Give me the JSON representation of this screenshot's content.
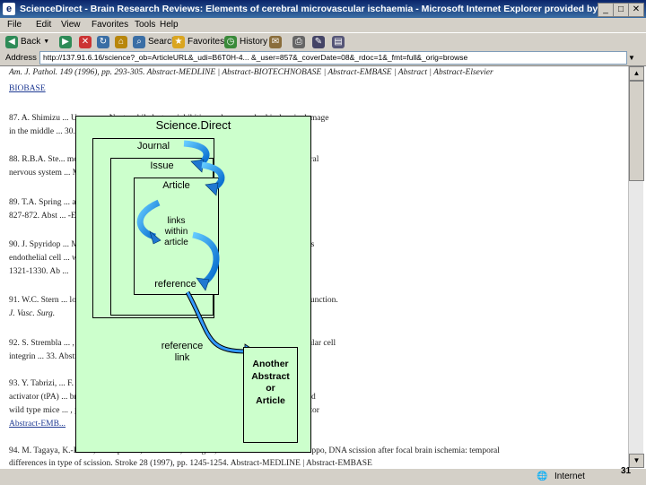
{
  "window": {
    "title": "ScienceDirect - Brain Research Reviews: Elements of cerebral microvascular ischaemia - Microsoft Internet Explorer provided by"
  },
  "menu": [
    "File",
    "Edit",
    "View",
    "Favorites",
    "Tools",
    "Help"
  ],
  "toolbar": {
    "back": "Back",
    "search": "Search",
    "favorites": "Favorites",
    "history": "History"
  },
  "address": {
    "label": "Address",
    "url": "http://137.91.6.16/science?_ob=ArticleURL&_udi=B6T0H-4... &_user=857&_coverDate=08&_rdoc=1&_fmt=full&_orig=browse"
  },
  "content": {
    "lines": [
      {
        "id": "l1",
        "text": "Am. J. Pathol. 149 (1996), pp. 293-305. Abstract-MEDLINE | Abstract-BIOTECHNOBASE | Abstract-EMBASE | Abstract | Abstract-Elsevier"
      },
      {
        "id": "l2",
        "text": "BIOBASE"
      },
      {
        "id": "l3",
        "text": "87. A. Shimizu ... Umemura, Neutrophil elastase inhibition reduces cerebral ischemic damage"
      },
      {
        "id": "l4",
        "text": "in the middle ... 30. SummaryPlus | Article | Journal Format-PDF (165 K)"
      },
      {
        "id": "l5",
        "text": "88. R.B.A. Ste... molecule-1 (ICAM-1) in coronary immune reactions in the human central"
      },
      {
        "id": "l6",
        "text": "nervous system ... MEDLINE | Abstract-EMBASE | Abstract-BIOTECHNOBASE"
      },
      {
        "id": "l7",
        "text": "89. T.A. Spring ... ation and leukocyte emigration. Annu. Rev. Physiol. 114 (1995), pp."
      },
      {
        "id": "l8",
        "text": "827-872. Abst ... -Elsevier BIOBASE"
      },
      {
        "id": "l9",
        "text": "90. J. Spyridop ... M. Isner and D.W. Losordo, Vascular endothelial growth factor inhibits"
      },
      {
        "id": "l10",
        "text": "endothelial cell ... ween growth and death signals. J. Mol. Cell Cardiol. 29 (1997), pp."
      },
      {
        "id": "l11",
        "text": "1321-1330. Ab ..."
      },
      {
        "id": "l12",
        "text": "91. W.C. Stern ... low anticoagulant potency attenuate postischemic endothelial cell dysfunction."
      },
      {
        "id": "l13",
        "text": "J. Vasc. Surg."
      },
      {
        "id": "l14",
        "text": "92. S. Strembla ... , Suppression of p53 activity and p21WAF1/CIP1 expression by vascular cell"
      },
      {
        "id": "l15",
        "text": "integrin ... 33. Abstract-EMBASE | Abstract"
      },
      {
        "id": "l16",
        "text": "93. Y. Tabrizi, ... F. Carmeliet, M.H. Weiss and R.V. Zlokovic, Tissue plasminogen"
      },
      {
        "id": "l17",
        "text": "activator (tPA) ... brain injury in a murine stroke model. Studies in tPA-deficient mice and"
      },
      {
        "id": "l18",
        "text": "wild type mice ... , pp. 2801-2806. Abstract-MEDLINE | Abstract-ScienceDirect Navigator"
      },
      {
        "id": "l19",
        "text": "Abstract-EMB..."
      },
      {
        "id": "l20",
        "text": "94. M. Tagaya, K.-P. Liu, B. Copeland, D. Seiffert, J. Engler, J.H. Garcia and G.J. del Zoppo, DNA scission after focal brain ischemia: temporal"
      },
      {
        "id": "l21",
        "text": "differences in type of scission. Stroke 28 (1997), pp. 1245-1254. Abstract-MEDLINE | Abstract-EMBASE"
      }
    ]
  },
  "status": {
    "zone": "Internet"
  },
  "slide": {
    "page_number": "31"
  },
  "diagram": {
    "title": "Science.Direct",
    "journal": "Journal",
    "issue": "Issue",
    "article": "Article",
    "links_within_article": [
      "links",
      "within",
      "article"
    ],
    "reference": "reference",
    "reference_link": [
      "reference",
      "link"
    ],
    "another": [
      "Another",
      "Abstract",
      "or",
      "Article"
    ]
  },
  "colors": {
    "diagram_fill": "#ccffcc",
    "arrow_fill": "#3399ff",
    "link_color": "#1f3a93",
    "titlebar": "#0a246a"
  }
}
